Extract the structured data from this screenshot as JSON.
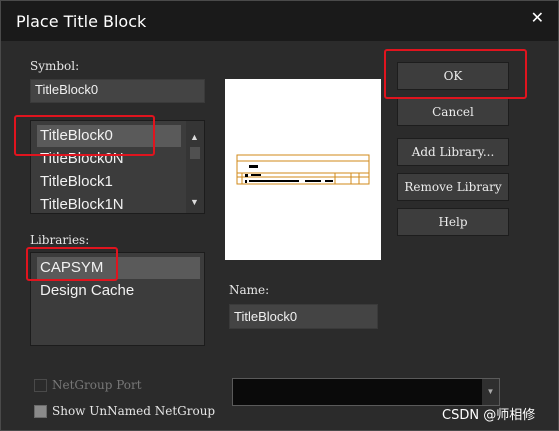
{
  "dialog": {
    "title": "Place Title Block"
  },
  "symbol": {
    "label": "Symbol:",
    "value": "TitleBlock0",
    "items": [
      "TitleBlock0",
      "TitleBlock0N",
      "TitleBlock1",
      "TitleBlock1N"
    ],
    "selected_index": 0
  },
  "libraries": {
    "label": "Libraries:",
    "items": [
      "CAPSYM",
      "Design Cache"
    ],
    "selected_index": 0
  },
  "buttons": {
    "ok": "OK",
    "cancel": "Cancel",
    "add_library": "Add Library...",
    "remove_library": "Remove Library",
    "help": "Help"
  },
  "name": {
    "label": "Name:",
    "value": "TitleBlock0"
  },
  "options": {
    "netgroup_port": {
      "label": "NetGroup Port",
      "checked": false,
      "enabled": false
    },
    "show_unnamed": {
      "label": "Show UnNamed NetGroup",
      "checked": false,
      "enabled": true
    }
  },
  "netgroup_combo": {
    "value": ""
  },
  "watermark": "CSDN @师相修",
  "colors": {
    "highlight": "#e0141e",
    "preview_lines": "#d08a1a"
  },
  "icons": [
    "close-icon",
    "scroll-up-icon",
    "scroll-down-icon",
    "dropdown-arrow-icon"
  ]
}
